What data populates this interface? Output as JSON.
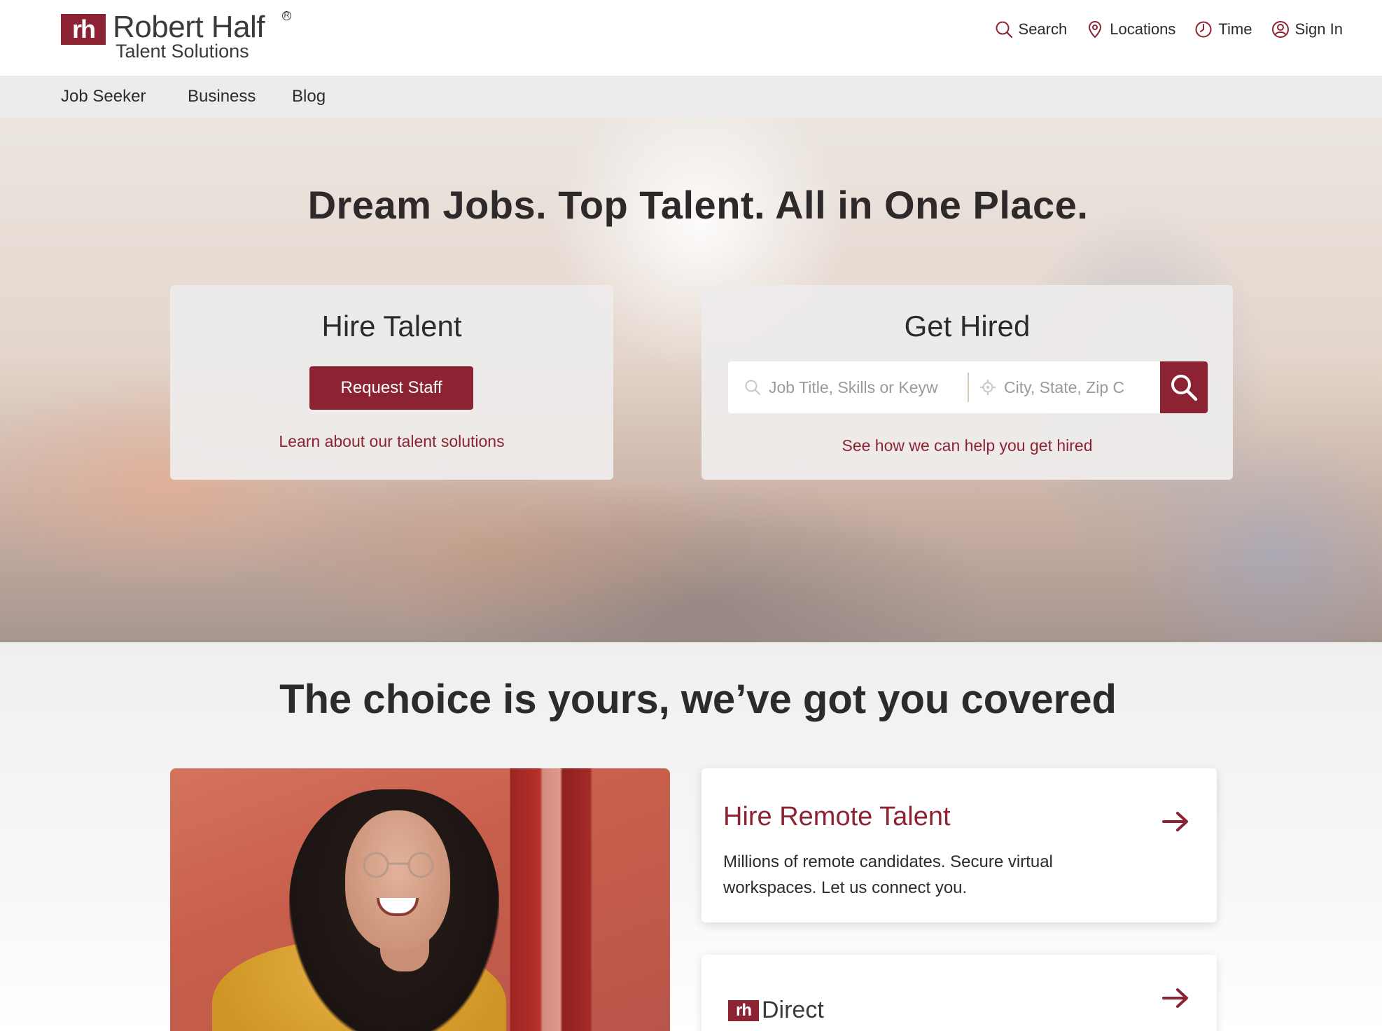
{
  "brand": {
    "mark": "rh",
    "name": "Robert Half",
    "registered": "R",
    "subtitle": "Talent Solutions",
    "color": "#8c2333"
  },
  "util_nav": {
    "search": {
      "label": "Search",
      "icon": "search-icon"
    },
    "locations": {
      "label": "Locations",
      "icon": "location-pin-icon"
    },
    "time": {
      "label": "Time",
      "icon": "clock-icon"
    },
    "sign_in": {
      "label": "Sign In",
      "icon": "user-icon"
    }
  },
  "sub_nav": {
    "items": [
      {
        "label": "Job Seeker"
      },
      {
        "label": "Business"
      },
      {
        "label": "Blog"
      }
    ]
  },
  "hero": {
    "title": "Dream Jobs. Top Talent. All in One Place.",
    "hire_card": {
      "title": "Hire Talent",
      "button": "Request Staff",
      "link": "Learn about our talent solutions"
    },
    "get_hired_card": {
      "title": "Get Hired",
      "keyword_placeholder": "Job Title, Skills or Keyw",
      "location_placeholder": "City, State, Zip C",
      "link": "See how we can help you get hired"
    }
  },
  "choice": {
    "title": "The choice is yours, we’ve got you covered",
    "tiles": [
      {
        "title": "Hire Remote Talent",
        "text": "Millions of remote candidates. Secure virtual workspaces. Let us connect you."
      },
      {
        "logo_mark": "rh",
        "logo_text": "Direct"
      }
    ]
  }
}
